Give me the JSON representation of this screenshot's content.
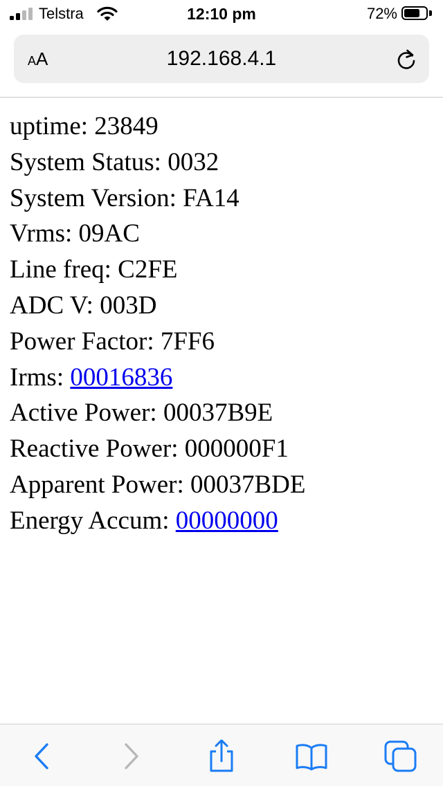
{
  "status_bar": {
    "carrier": "Telstra",
    "time": "12:10 pm",
    "battery_percent": "72%",
    "battery_level": 0.72,
    "signal_bars": 2
  },
  "browser": {
    "text_size_label": "AA",
    "url": "192.168.4.1"
  },
  "page": {
    "lines": [
      {
        "label": "uptime: ",
        "value": "23849",
        "link": false
      },
      {
        "label": "System Status: ",
        "value": "0032",
        "link": false
      },
      {
        "label": "System Version: ",
        "value": "FA14",
        "link": false
      },
      {
        "label": "Vrms: ",
        "value": "09AC",
        "link": false
      },
      {
        "label": "Line freq: ",
        "value": "C2FE",
        "link": false
      },
      {
        "label": "ADC V: ",
        "value": "003D",
        "link": false
      },
      {
        "label": "Power Factor: ",
        "value": "7FF6",
        "link": false
      },
      {
        "label": "Irms: ",
        "value": "00016836",
        "link": true
      },
      {
        "label": "Active Power: ",
        "value": "00037B9E",
        "link": false
      },
      {
        "label": "Reactive Power: ",
        "value": "000000F1",
        "link": false
      },
      {
        "label": "Apparent Power: ",
        "value": "00037BDE",
        "link": false
      },
      {
        "label": "Energy Accum: ",
        "value": "00000000",
        "link": true
      }
    ]
  },
  "toolbar": {
    "icons": [
      "back-icon",
      "forward-icon",
      "share-icon",
      "bookmarks-icon",
      "tabs-icon"
    ],
    "accent_color": "#1a7cf5",
    "disabled_color": "#b8b8b8"
  }
}
